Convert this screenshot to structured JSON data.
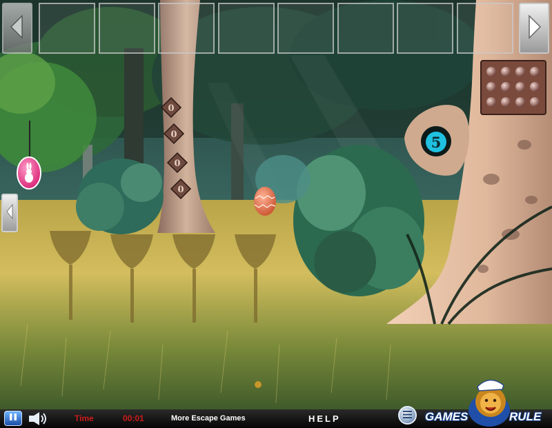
{
  "window": {
    "title": ""
  },
  "inventory": {
    "slot_count": 8,
    "left_arrow_icon": "chevron-left-icon",
    "right_arrow_icon": "chevron-right-icon"
  },
  "scene": {
    "tree_clue_digits": [
      "0",
      "0",
      "0",
      "0"
    ],
    "tree_hole_number": "5",
    "hanging_tag_icon": "bunny-icon",
    "grid_panel_buttons": 12,
    "flower_silhouettes": 4
  },
  "bottom_bar": {
    "time_label": "Time",
    "time_value": "00:01",
    "more_games": "More Escape Games",
    "help": "HELP",
    "logo_left": "GAMES",
    "logo_right": "RULE"
  },
  "colors": {
    "grass": "#b7a64a",
    "foliage": "#2f6b52",
    "trunk": "#c9a88e",
    "egg_pink": "#e23b84",
    "egg_orange": "#e8704a",
    "hole_number": "#1fc0e0",
    "time_text": "#cc1b1b",
    "panel_brown": "#7a4a3c"
  }
}
